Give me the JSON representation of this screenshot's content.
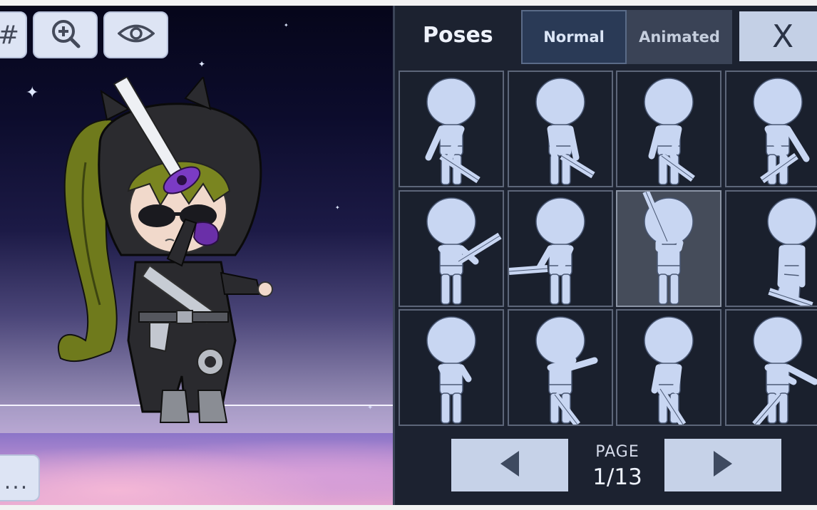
{
  "toolbar": {
    "hash_label": "#",
    "zoom_icon": "zoom-in-icon",
    "eye_icon": "eye-icon",
    "more_label": "..."
  },
  "panel": {
    "title": "Poses",
    "tabs": [
      {
        "label": "Normal",
        "selected": true
      },
      {
        "label": "Animated",
        "selected": false
      }
    ],
    "close_label": "X",
    "page_label": "PAGE",
    "page_value": "1/13",
    "prev_icon": "left-arrow-icon",
    "next_icon": "right-arrow-icon",
    "selected_pose_index": 6
  },
  "colors": {
    "panel_bg": "#1c2230",
    "button_bg": "#c6d2e8",
    "pose_figure": "#c8d6f2"
  }
}
